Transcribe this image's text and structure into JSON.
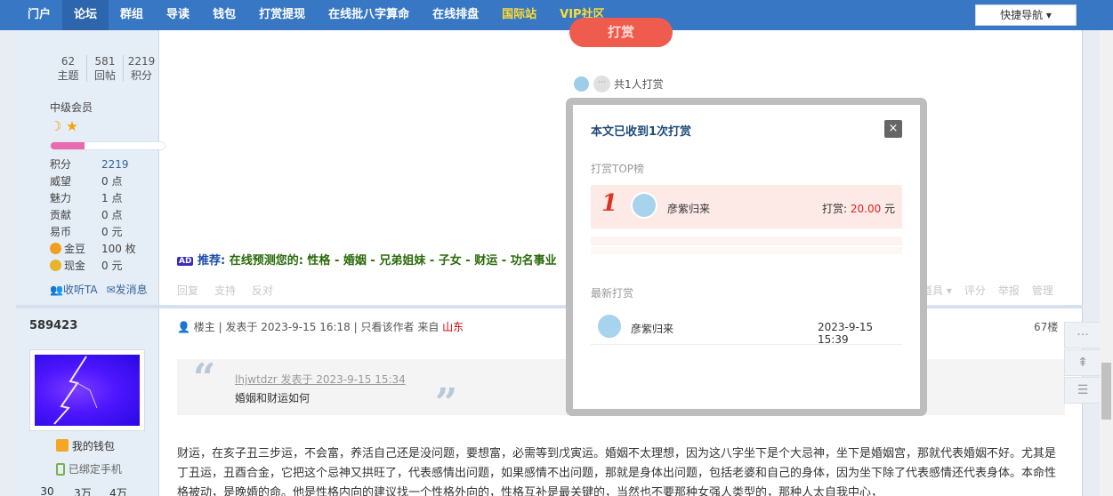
{
  "nav": {
    "items": [
      {
        "label": "门户",
        "active": false,
        "gold": false
      },
      {
        "label": "论坛",
        "active": true,
        "gold": false
      },
      {
        "label": "群组",
        "active": false,
        "gold": false
      },
      {
        "label": "导读",
        "active": false,
        "gold": false
      },
      {
        "label": "钱包",
        "active": false,
        "gold": false
      },
      {
        "label": "打赏提现",
        "active": false,
        "gold": false
      },
      {
        "label": "在线批八字算命",
        "active": false,
        "gold": false
      },
      {
        "label": "在线排盘",
        "active": false,
        "gold": false
      },
      {
        "label": "国际站",
        "active": false,
        "gold": true
      },
      {
        "label": "VIP社区",
        "active": false,
        "gold": true
      }
    ],
    "quicknav": "快捷导航 ▾"
  },
  "sidebar": {
    "stats": [
      {
        "value": "62",
        "label": "主题"
      },
      {
        "value": "581",
        "label": "回帖"
      },
      {
        "value": "2219",
        "label": "积分"
      }
    ],
    "rank": "中级会员",
    "level_progress": 0.3,
    "info": [
      {
        "k": "积分",
        "v": "2219",
        "blue": true,
        "coin": ""
      },
      {
        "k": "威望",
        "v": "0 点",
        "blue": false,
        "coin": ""
      },
      {
        "k": "魅力",
        "v": "1 点",
        "blue": false,
        "coin": ""
      },
      {
        "k": "贡献",
        "v": "0 点",
        "blue": false,
        "coin": ""
      },
      {
        "k": "易币",
        "v": "0 元",
        "blue": false,
        "coin": ""
      },
      {
        "k": "金豆",
        "v": "100 枚",
        "blue": false,
        "coin": "#f0a020"
      },
      {
        "k": "现金",
        "v": "0 元",
        "blue": false,
        "coin": "#e8b42a"
      }
    ],
    "follow": "收听TA",
    "message": "发消息",
    "username2": "589423",
    "wallet": "我的钱包",
    "phone": "已绑定手机",
    "bottom_stats": [
      "30",
      "3万",
      "4万"
    ]
  },
  "post": {
    "reward_btn": "打赏",
    "supporters_text": "共1人打赏",
    "recommend_label": "推荐:",
    "recommend_text": "在线预测您的: 性格 - 婚姻 - 兄弟姐妹 - 子女 - 财运 - 功名事业",
    "ad": "AD",
    "actions": [
      "回复",
      "支持",
      "反对"
    ],
    "actions_right": [
      "道具 ▾",
      "评分",
      "举报",
      "管理"
    ]
  },
  "reply": {
    "role": "楼主",
    "posted": "发表于 2023-9-15 16:18",
    "only_author": "只看该作者",
    "from": "来自",
    "location": "山东",
    "floor": "67楼",
    "quote_src": "lhjwtdzr 发表于 2023-9-15 15:34",
    "quote_text": "婚姻和财运如何",
    "body": "财运，在亥子丑三步运，不会富，养活自己还是没问题，要想富，必需等到戊寅运。婚姻不太理想，因为这八字坐下是个大忌神，坐下是婚姻宫，那就代表婚姻不好。尤其是丁丑运，丑酉合金，它把这个忌神又拱旺了，代表感情出问题，如果感情不出问题，那就是身体出问题，包括老婆和自己的身体，因为坐下除了代表感情还代表身体。本命性格被动，是晚婚的命。他是性格内向的建议找一个性格外向的，性格互补是最关键的，当然也不要那种女强人类型的，那种人太自我中心，"
  },
  "modal": {
    "title": "本文已收到1次打赏",
    "close": "×",
    "top_label": "打赏TOP榜",
    "top_rank": "1",
    "top_name": "彦紫归来",
    "top_amount_label": "打赏: ",
    "top_amount": "20.00",
    "top_unit": " 元",
    "latest_label": "最新打赏",
    "latest_name": "彦紫归来",
    "latest_time": "2023-9-15 15:39"
  },
  "tools": [
    "···",
    "⇞",
    "☰"
  ],
  "colors": {
    "nav_bg": "#3777c3",
    "accent_red": "#ef5b4c",
    "gold": "#ffdd33"
  }
}
